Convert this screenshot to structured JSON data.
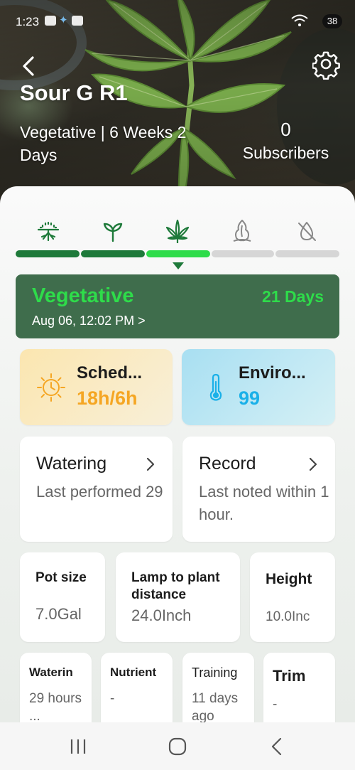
{
  "status_bar": {
    "time": "1:23",
    "battery": "38"
  },
  "header": {
    "plant_name": "Sour G R1",
    "stage_line": "Vegetative | 6 Weeks 2 Days",
    "subscribers_count": "0",
    "subscribers_label": "Subscribers"
  },
  "stages": [
    {
      "icon": "germination-icon",
      "done": true
    },
    {
      "icon": "seedling-icon",
      "done": true
    },
    {
      "icon": "vegetative-leaf-icon",
      "done": true,
      "current": true
    },
    {
      "icon": "flowering-bud-icon",
      "done": false
    },
    {
      "icon": "drying-icon",
      "done": false
    }
  ],
  "phase": {
    "title": "Vegetative",
    "days": "21 Days",
    "date": "Aug 06, 12:02 PM >"
  },
  "schedule": {
    "title": "Sched...",
    "value": "18h/6h",
    "icon": "sun-clock-icon"
  },
  "environment": {
    "title": "Enviro...",
    "value": "99",
    "icon": "thermometer-icon"
  },
  "watering": {
    "title": "Watering",
    "detail": "Last performed 29"
  },
  "record": {
    "title": "Record",
    "detail": "Last noted within 1 hour."
  },
  "pot": {
    "title": "Pot size",
    "value": "7.0Gal"
  },
  "lamp": {
    "title": "Lamp to plant distance",
    "value": "24.0Inch"
  },
  "height": {
    "title": "Height",
    "value": "10.0Inc"
  },
  "small_cards": [
    {
      "title": "Waterin",
      "value": "29 hours ..."
    },
    {
      "title": "Nutrient",
      "value": "-"
    },
    {
      "title": "Training",
      "value": "11 days ago"
    },
    {
      "title": "Trim",
      "value": "-"
    }
  ],
  "colors": {
    "accent_green": "#2edc4a",
    "dark_green": "#1e7a3a",
    "phase_card": "#3f6d4c",
    "schedule_value": "#f5a623",
    "environment_value": "#1ab0e8"
  }
}
